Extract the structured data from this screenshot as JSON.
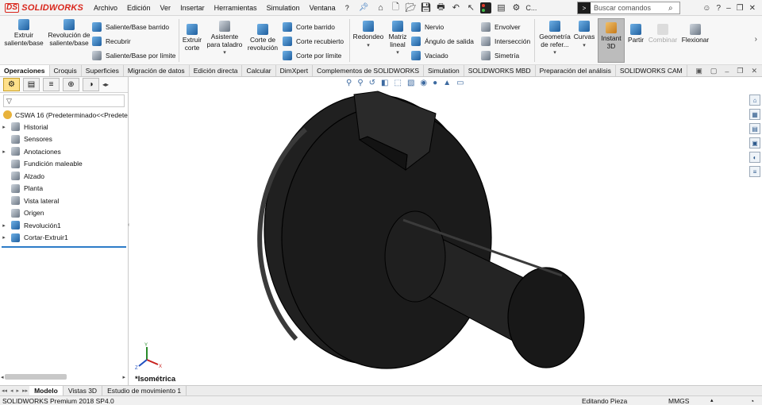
{
  "app": {
    "brand": "SOLIDWORKS",
    "window_title_short": "C..."
  },
  "menu": [
    "Archivo",
    "Edición",
    "Ver",
    "Insertar",
    "Herramientas",
    "Simulation",
    "Ventana",
    "?"
  ],
  "search": {
    "placeholder": "Buscar comandos"
  },
  "ribbon": {
    "extrude_boss": "Extruir saliente/base",
    "revolve_boss": "Revolución de saliente/base",
    "swept_boss": "Saliente/Base barrido",
    "lofted_boss": "Recubrir",
    "boundary_boss": "Saliente/Base por límite",
    "extrude_cut": "Extruir corte",
    "hole_wizard": "Asistente para taladro",
    "revolve_cut": "Corte de revolución",
    "swept_cut": "Corte barrido",
    "lofted_cut": "Corte recubierto",
    "boundary_cut": "Corte por límite",
    "fillet": "Redondeo",
    "linear_pattern": "Matriz lineal",
    "rib": "Nervio",
    "draft": "Ángulo de salida",
    "shell": "Vaciado",
    "wrap": "Envolver",
    "intersect": "Intersección",
    "mirror": "Simetría",
    "ref_geometry": "Geometría de refer...",
    "curves": "Curvas",
    "instant3d": "Instant 3D",
    "split": "Partir",
    "combine": "Combinar",
    "flex": "Flexionar"
  },
  "tabs": [
    "Operaciones",
    "Croquis",
    "Superficies",
    "Migración de datos",
    "Edición directa",
    "Calcular",
    "DimXpert",
    "Complementos de SOLIDWORKS",
    "Simulation",
    "SOLIDWORKS MBD",
    "Preparación del análisis",
    "SOLIDWORKS CAM"
  ],
  "active_tab": "Operaciones",
  "tree": {
    "root": "CSWA 16  (Predeterminado<<Predete",
    "items": [
      {
        "label": "Historial",
        "expandable": true
      },
      {
        "label": "Sensores",
        "expandable": false
      },
      {
        "label": "Anotaciones",
        "expandable": true
      },
      {
        "label": "Fundición maleable",
        "expandable": false
      },
      {
        "label": "Alzado",
        "expandable": false
      },
      {
        "label": "Planta",
        "expandable": false
      },
      {
        "label": "Vista lateral",
        "expandable": false
      },
      {
        "label": "Origen",
        "expandable": false
      },
      {
        "label": "Revolución1",
        "expandable": true
      },
      {
        "label": "Cortar-Extruir1",
        "expandable": true
      }
    ]
  },
  "viewport": {
    "view_label": "*Isométrica"
  },
  "bottom_tabs": [
    "Modelo",
    "Vistas 3D",
    "Estudio de movimiento 1"
  ],
  "active_bottom_tab": "Modelo",
  "status": {
    "product": "SOLIDWORKS Premium 2018 SP4.0",
    "mode": "Editando Pieza",
    "units": "MMGS"
  },
  "colors": {
    "brand_red": "#d9261c",
    "part_body": "#1e1e1e",
    "selection_blue": "#2d7cc8"
  }
}
